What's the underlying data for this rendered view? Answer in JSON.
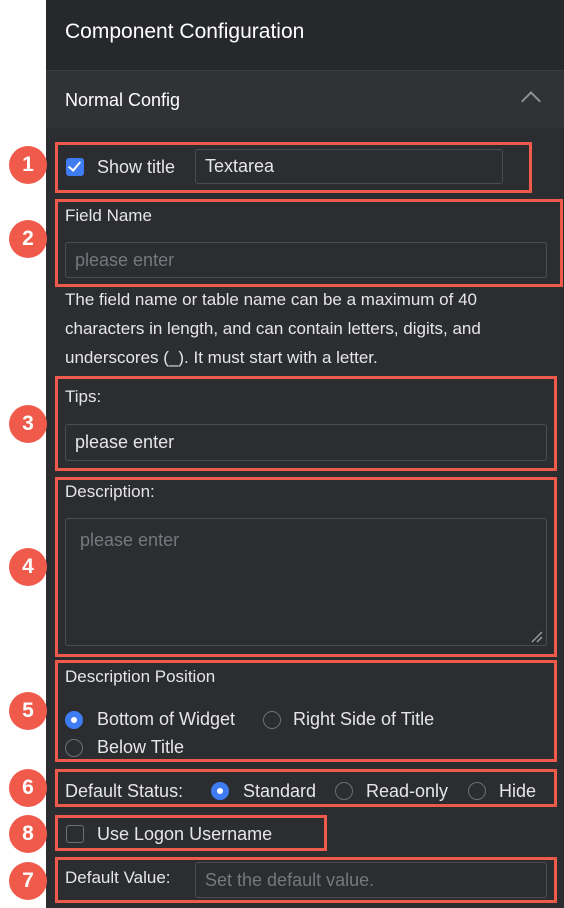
{
  "panel": {
    "title": "Component Configuration"
  },
  "section": {
    "title": "Normal Config"
  },
  "markers": [
    "1",
    "2",
    "3",
    "4",
    "5",
    "6",
    "8",
    "7"
  ],
  "show_title": {
    "label": "Show title",
    "checked": true,
    "value": "Textarea"
  },
  "field_name": {
    "label": "Field Name",
    "placeholder": "please enter",
    "help": "The field name or table name can be a maximum of 40 characters in length, and can contain letters, digits, and underscores (_). It must start with a letter."
  },
  "tips": {
    "label": "Tips:",
    "value": "please enter"
  },
  "description": {
    "label": "Description:",
    "placeholder": "please enter"
  },
  "description_position": {
    "label": "Description Position",
    "options": [
      "Bottom of Widget",
      "Right Side of Title",
      "Below Title"
    ],
    "selected": "Bottom of Widget"
  },
  "default_status": {
    "label": "Default Status:",
    "options": [
      "Standard",
      "Read-only",
      "Hide"
    ],
    "selected": "Standard"
  },
  "logon": {
    "label": "Use Logon Username",
    "checked": false
  },
  "default_value": {
    "label": "Default Value:",
    "placeholder": "Set the default value."
  },
  "colors": {
    "highlight": "#ef5a4b",
    "accent": "#3f7cf2",
    "panel": "#2b2d31"
  }
}
